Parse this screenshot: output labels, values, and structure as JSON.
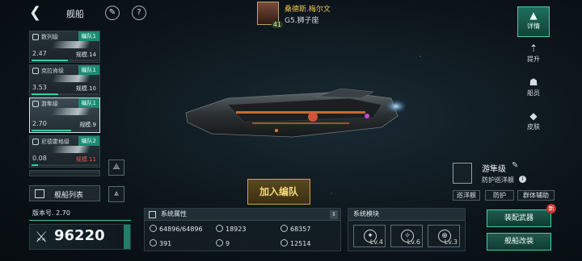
{
  "header": {
    "back_icon": "back-arrow-icon",
    "title": "舰船",
    "edit_icon": "feather-icon",
    "help_icon": "question-icon"
  },
  "player": {
    "name": "桑德斯.梅尔文",
    "server": "G5.狮子座",
    "level": "41"
  },
  "ship_list": [
    {
      "name": "数列级",
      "team": "编队1",
      "number": "2.47",
      "scale": "规模.14",
      "bar": 0.55,
      "scale_warn": false
    },
    {
      "name": "克拉肯级",
      "team": "编队1",
      "number": "3.53",
      "scale": "规模.10",
      "bar": 0.4,
      "scale_warn": false
    },
    {
      "name": "游隼级",
      "team": "编队1",
      "number": "2.70",
      "scale": "规模.9",
      "bar": 0.6,
      "scale_warn": false
    },
    {
      "name": "尼德霍格级",
      "team": "编队2",
      "number": "0.08",
      "scale": "规模.11",
      "bar": 0.1,
      "scale_warn": true
    }
  ],
  "ship_list_button": "舰船列表",
  "join_fleet_button": "加入编队",
  "ship": {
    "class_name": "游隼级",
    "class_type": "防护巡洋舰",
    "tags": [
      "巡洋舰",
      "防护",
      "群体辅助"
    ]
  },
  "right_tabs": [
    {
      "label": "详情",
      "icon": "details-icon",
      "active": true
    },
    {
      "label": "提升",
      "icon": "upgrade-icon",
      "active": false
    },
    {
      "label": "船员",
      "icon": "crew-icon",
      "active": false
    },
    {
      "label": "皮肤",
      "icon": "skin-icon",
      "active": false
    }
  ],
  "version": "版本号. 2.70",
  "combat_power": "96220",
  "attributes": {
    "header": "系统属性",
    "items": [
      {
        "icon": "shield-hp-icon",
        "value": "64896/64896"
      },
      {
        "icon": "armor-icon",
        "value": "18923"
      },
      {
        "icon": "energy-icon",
        "value": "68357"
      },
      {
        "icon": "speed-icon",
        "value": "391"
      },
      {
        "icon": "crew-count-icon",
        "value": "9"
      },
      {
        "icon": "structure-icon",
        "value": "12514"
      }
    ]
  },
  "modules": {
    "header": "系统模块",
    "items": [
      {
        "icon": "module-a-icon",
        "level": "Lv.4"
      },
      {
        "icon": "module-b-icon",
        "level": "Lv.6"
      },
      {
        "icon": "module-c-icon",
        "level": "Lv.3"
      }
    ]
  },
  "equip_button": "装配武器",
  "equip_badge": "新",
  "refit_button": "舰船改装",
  "colors": {
    "accent": "#2ed3a2",
    "gold": "#f1c24e",
    "warn": "#e35b4b"
  }
}
